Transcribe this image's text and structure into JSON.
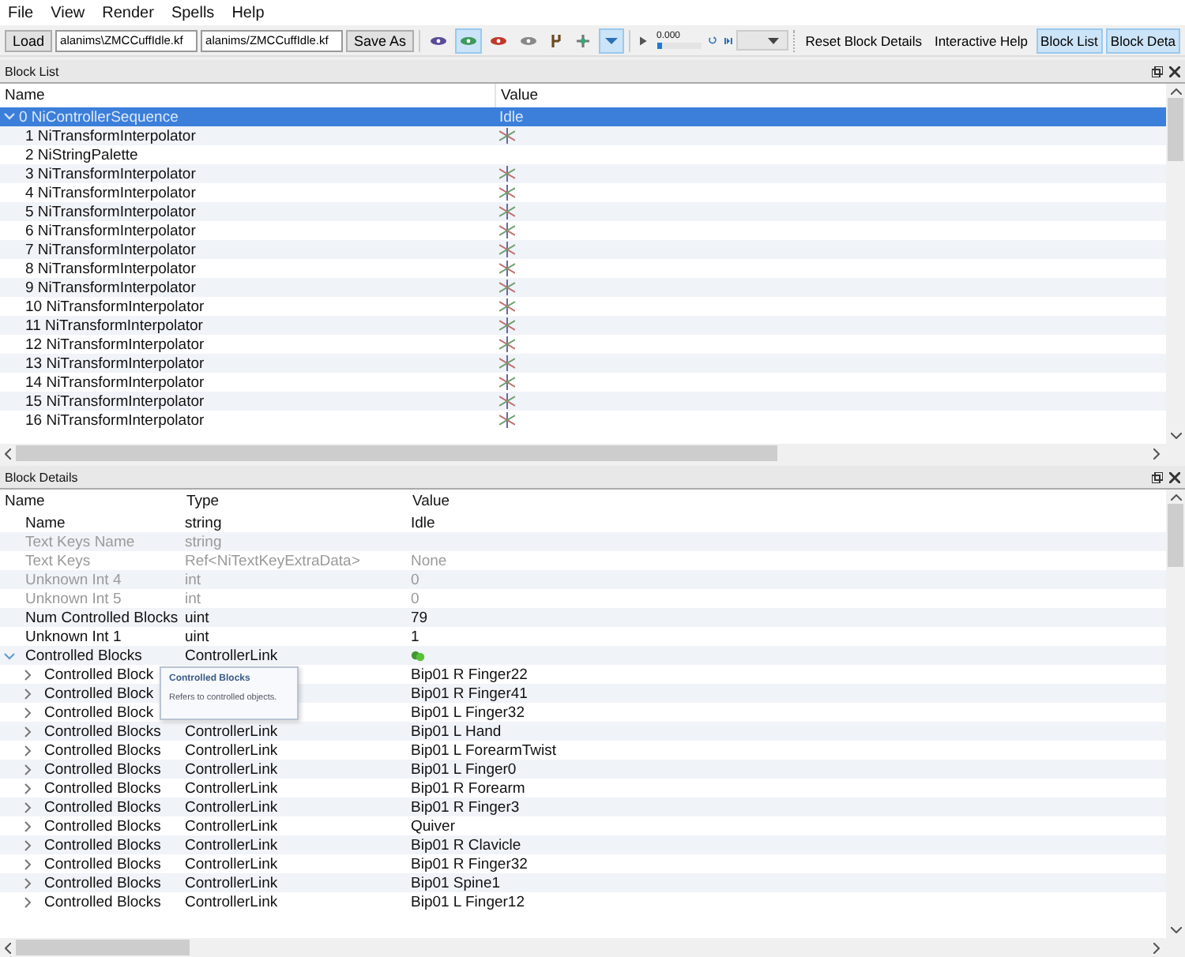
{
  "menu": [
    "File",
    "View",
    "Render",
    "Spells",
    "Help"
  ],
  "toolbar": {
    "load_button": "Load",
    "path_fields": [
      "alanims\\ZMCCuffIdle.kf",
      "alanims/ZMCCuffIdle.kf"
    ],
    "save_button": "Save As",
    "view_tools": [
      {
        "selected": false
      },
      {
        "selected": true
      },
      {
        "selected": false
      },
      {
        "selected": false
      },
      {
        "selected": false
      },
      {
        "selected": false
      },
      {
        "selected": true
      }
    ],
    "time_slider": {
      "reading": "0.000",
      "level": 0.12
    },
    "right_buttons": [
      {
        "label": "Reset Block Details",
        "selected": false
      },
      {
        "label": "Interactive Help",
        "selected": false
      },
      {
        "label": "Block List",
        "selected": true
      },
      {
        "label": "Block Deta",
        "selected": true
      }
    ]
  },
  "block_list": {
    "title": "Block List",
    "columns": [
      "Name",
      "Value"
    ],
    "rows": [
      {
        "name": "0 NiControllerSequence",
        "value": "Idle",
        "selected": true,
        "expanded": true,
        "children": [
          {
            "name": "1 NiTransformInterpolator",
            "value_icon": true
          },
          {
            "name": "2 NiStringPalette"
          },
          {
            "name": "3 NiTransformInterpolator",
            "value_icon": true
          },
          {
            "name": "4 NiTransformInterpolator",
            "value_icon": true
          },
          {
            "name": "5 NiTransformInterpolator",
            "value_icon": true
          },
          {
            "name": "6 NiTransformInterpolator",
            "value_icon": true
          },
          {
            "name": "7 NiTransformInterpolator",
            "value_icon": true
          },
          {
            "name": "8 NiTransformInterpolator",
            "value_icon": true
          },
          {
            "name": "9 NiTransformInterpolator",
            "value_icon": true
          },
          {
            "name": "10 NiTransformInterpolator",
            "value_icon": true
          },
          {
            "name": "11 NiTransformInterpolator",
            "value_icon": true
          },
          {
            "name": "12 NiTransformInterpolator",
            "value_icon": true
          },
          {
            "name": "13 NiTransformInterpolator",
            "value_icon": true
          },
          {
            "name": "14 NiTransformInterpolator",
            "value_icon": true
          },
          {
            "name": "15 NiTransformInterpolator",
            "value_icon": true
          },
          {
            "name": "16 NiTransformInterpolator",
            "value_icon": true
          }
        ]
      }
    ]
  },
  "block_details": {
    "title": "Block Details",
    "columns": [
      "Name",
      "Type",
      "Value"
    ],
    "rows": [
      {
        "name": "Name",
        "type": "string",
        "value": "Idle",
        "disabled": false
      },
      {
        "name": "Text Keys Name",
        "type": "string",
        "disabled": true
      },
      {
        "name": "Text Keys",
        "type": "Ref<NiTextKeyExtraData>",
        "value": "None",
        "disabled": true
      },
      {
        "name": "Unknown Int 4",
        "type": "int",
        "value": "0",
        "disabled": true
      },
      {
        "name": "Unknown Int 5",
        "type": "int",
        "value": "0",
        "disabled": true
      },
      {
        "name": "Num Controlled Blocks",
        "type": "uint",
        "value": "79",
        "disabled": false
      },
      {
        "name": "Unknown Int 1",
        "type": "uint",
        "value": "1",
        "disabled": false
      },
      {
        "name": "Controlled Blocks",
        "type": "ControllerLink",
        "value_icon": true,
        "disabled": false,
        "expanded": true,
        "children": [
          {
            "name": "Controlled Block",
            "value": "Bip01 R Finger22",
            "expanded": false
          },
          {
            "name": "Controlled Block",
            "value": "Bip01 R Finger41",
            "expanded": false
          },
          {
            "name": "Controlled Block",
            "value": "Bip01 L Finger32",
            "expanded": false
          },
          {
            "name": "Controlled Blocks",
            "type": "ControllerLink",
            "value": "Bip01 L Hand",
            "expanded": false
          },
          {
            "name": "Controlled Blocks",
            "type": "ControllerLink",
            "value": "Bip01 L ForearmTwist",
            "expanded": false
          },
          {
            "name": "Controlled Blocks",
            "type": "ControllerLink",
            "value": "Bip01 L Finger0",
            "expanded": false
          },
          {
            "name": "Controlled Blocks",
            "type": "ControllerLink",
            "value": "Bip01 R Forearm",
            "expanded": false
          },
          {
            "name": "Controlled Blocks",
            "type": "ControllerLink",
            "value": "Bip01 R Finger3",
            "expanded": false
          },
          {
            "name": "Controlled Blocks",
            "type": "ControllerLink",
            "value": "Quiver",
            "expanded": false
          },
          {
            "name": "Controlled Blocks",
            "type": "ControllerLink",
            "value": "Bip01 R Clavicle",
            "expanded": false
          },
          {
            "name": "Controlled Blocks",
            "type": "ControllerLink",
            "value": "Bip01 R Finger32",
            "expanded": false
          },
          {
            "name": "Controlled Blocks",
            "type": "ControllerLink",
            "value": "Bip01 Spine1",
            "expanded": false
          },
          {
            "name": "Controlled Blocks",
            "type": "ControllerLink",
            "value": "Bip01 L Finger12",
            "expanded": false
          }
        ]
      }
    ],
    "tooltip": {
      "title": "Controlled Blocks",
      "text": "Refers to controlled objects."
    }
  }
}
